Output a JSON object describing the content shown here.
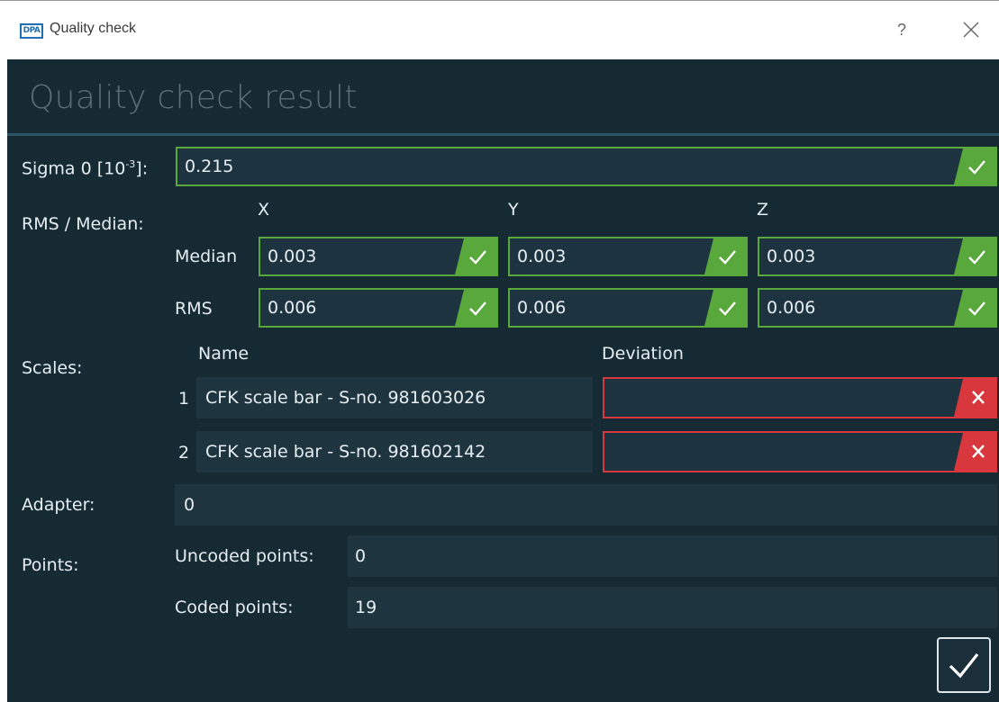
{
  "window": {
    "logo_text": "DPA",
    "title": "Quality check",
    "help_label": "?"
  },
  "dialog": {
    "heading": "Quality check result",
    "sigma": {
      "label_prefix": "Sigma 0 [10",
      "label_exp": "-3",
      "label_suffix": "]:",
      "value": "0.215",
      "status": "ok"
    },
    "rms_median": {
      "label": "RMS / Median:",
      "columns": [
        "X",
        "Y",
        "Z"
      ],
      "rows": [
        {
          "label": "Median",
          "values": [
            "0.003",
            "0.003",
            "0.003"
          ]
        },
        {
          "label": "RMS",
          "values": [
            "0.006",
            "0.006",
            "0.006"
          ]
        }
      ]
    },
    "scales": {
      "label": "Scales:",
      "name_header": "Name",
      "deviation_header": "Deviation",
      "items": [
        {
          "index": "1",
          "name": "CFK scale bar - S-no. 981603026",
          "deviation": "",
          "status": "error"
        },
        {
          "index": "2",
          "name": "CFK scale bar - S-no. 981602142",
          "deviation": "",
          "status": "error"
        }
      ]
    },
    "adapter": {
      "label": "Adapter:",
      "value": "0"
    },
    "points": {
      "label": "Points:",
      "uncoded_label": "Uncoded points:",
      "uncoded_value": "0",
      "coded_label": "Coded points:",
      "coded_value": "19"
    }
  },
  "colors": {
    "background": "#162a34",
    "ok": "#58a83b",
    "error": "#d8383d"
  },
  "icons": {
    "ok": "checkmark-icon",
    "error": "close-x-icon",
    "confirm": "checkmark-icon"
  }
}
